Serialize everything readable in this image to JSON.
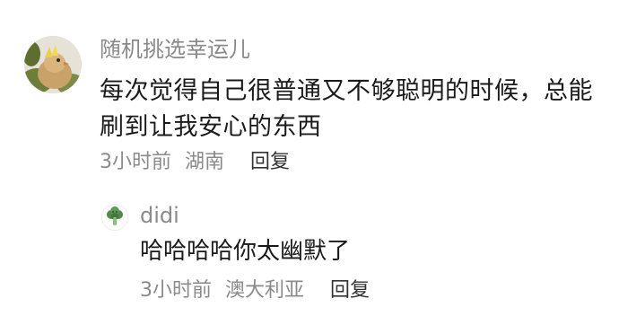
{
  "comment": {
    "username": "随机挑选幸运儿",
    "text": "每次觉得自己很普通又不够聪明的时候，总能刷到让我安心的东西",
    "time": "3小时前",
    "location": "湖南",
    "reply_label": "回复",
    "avatar_icon": "bird-avatar-icon"
  },
  "reply": {
    "username": "didi",
    "text": "哈哈哈哈你太幽默了",
    "time": "3小时前",
    "location": "澳大利亚",
    "reply_label": "回复",
    "avatar_icon": "broccoli-avatar-icon"
  },
  "colors": {
    "meta_text": "#8a8a8a",
    "body_text": "#1a1a1a",
    "reply_link": "#333333"
  }
}
